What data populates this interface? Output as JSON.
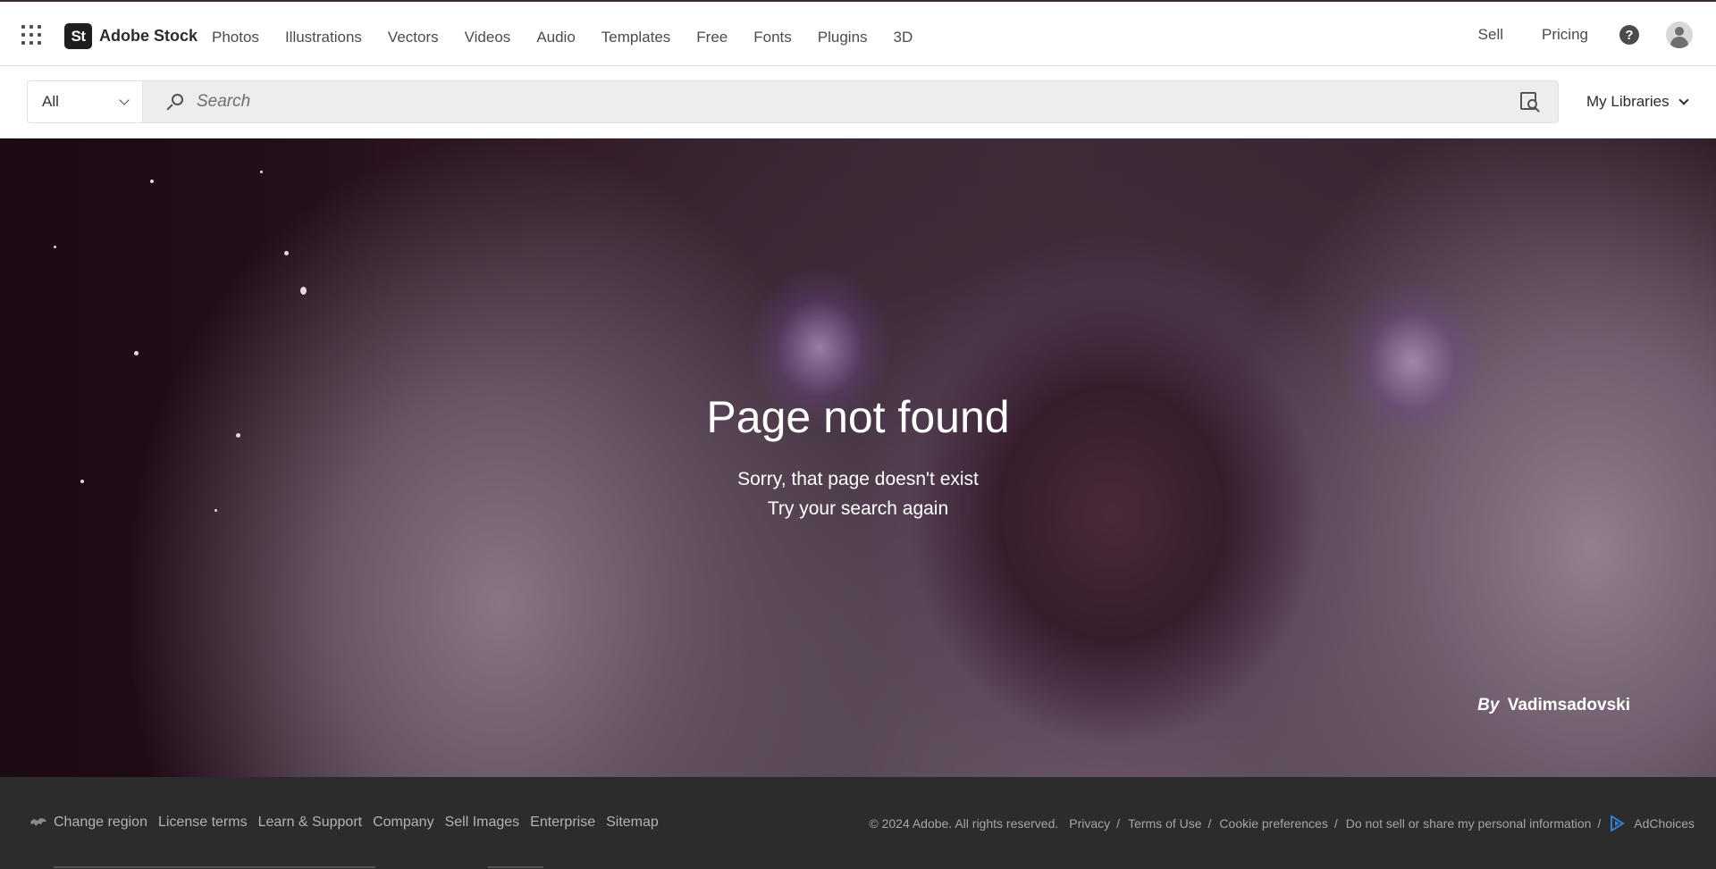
{
  "brand": {
    "logo_text": "St",
    "name": "Adobe Stock"
  },
  "nav": {
    "items": [
      "Photos",
      "Illustrations",
      "Vectors",
      "Videos",
      "Audio",
      "Templates",
      "Free",
      "Fonts",
      "Plugins",
      "3D"
    ],
    "sell": "Sell",
    "pricing": "Pricing",
    "help_glyph": "?"
  },
  "search": {
    "category": "All",
    "placeholder": "Search",
    "my_libraries": "My Libraries"
  },
  "hero": {
    "title": "Page not found",
    "line1": "Sorry, that page doesn't exist",
    "line2": "Try your search again",
    "credit_by": "By",
    "credit_author": "Vadimsadovski"
  },
  "footer": {
    "links": [
      "Change region",
      "License terms",
      "Learn & Support",
      "Company",
      "Sell Images",
      "Enterprise",
      "Sitemap"
    ],
    "copyright": "© 2024 Adobe. All rights reserved.",
    "legal": [
      "Privacy",
      "Terms of Use",
      "Cookie preferences",
      "Do not sell or share my personal information"
    ],
    "separator": "/",
    "adchoices": "AdChoices"
  },
  "colors": {
    "footer_bg": "#2c2c2c",
    "search_bg": "#ededed",
    "adchoices_blue": "#2f7fd8"
  },
  "icons": [
    "apps-grid-icon",
    "help-icon",
    "avatar-icon",
    "chevron-down-icon",
    "search-icon",
    "visual-search-icon",
    "globe-icon",
    "adchoices-icon"
  ]
}
